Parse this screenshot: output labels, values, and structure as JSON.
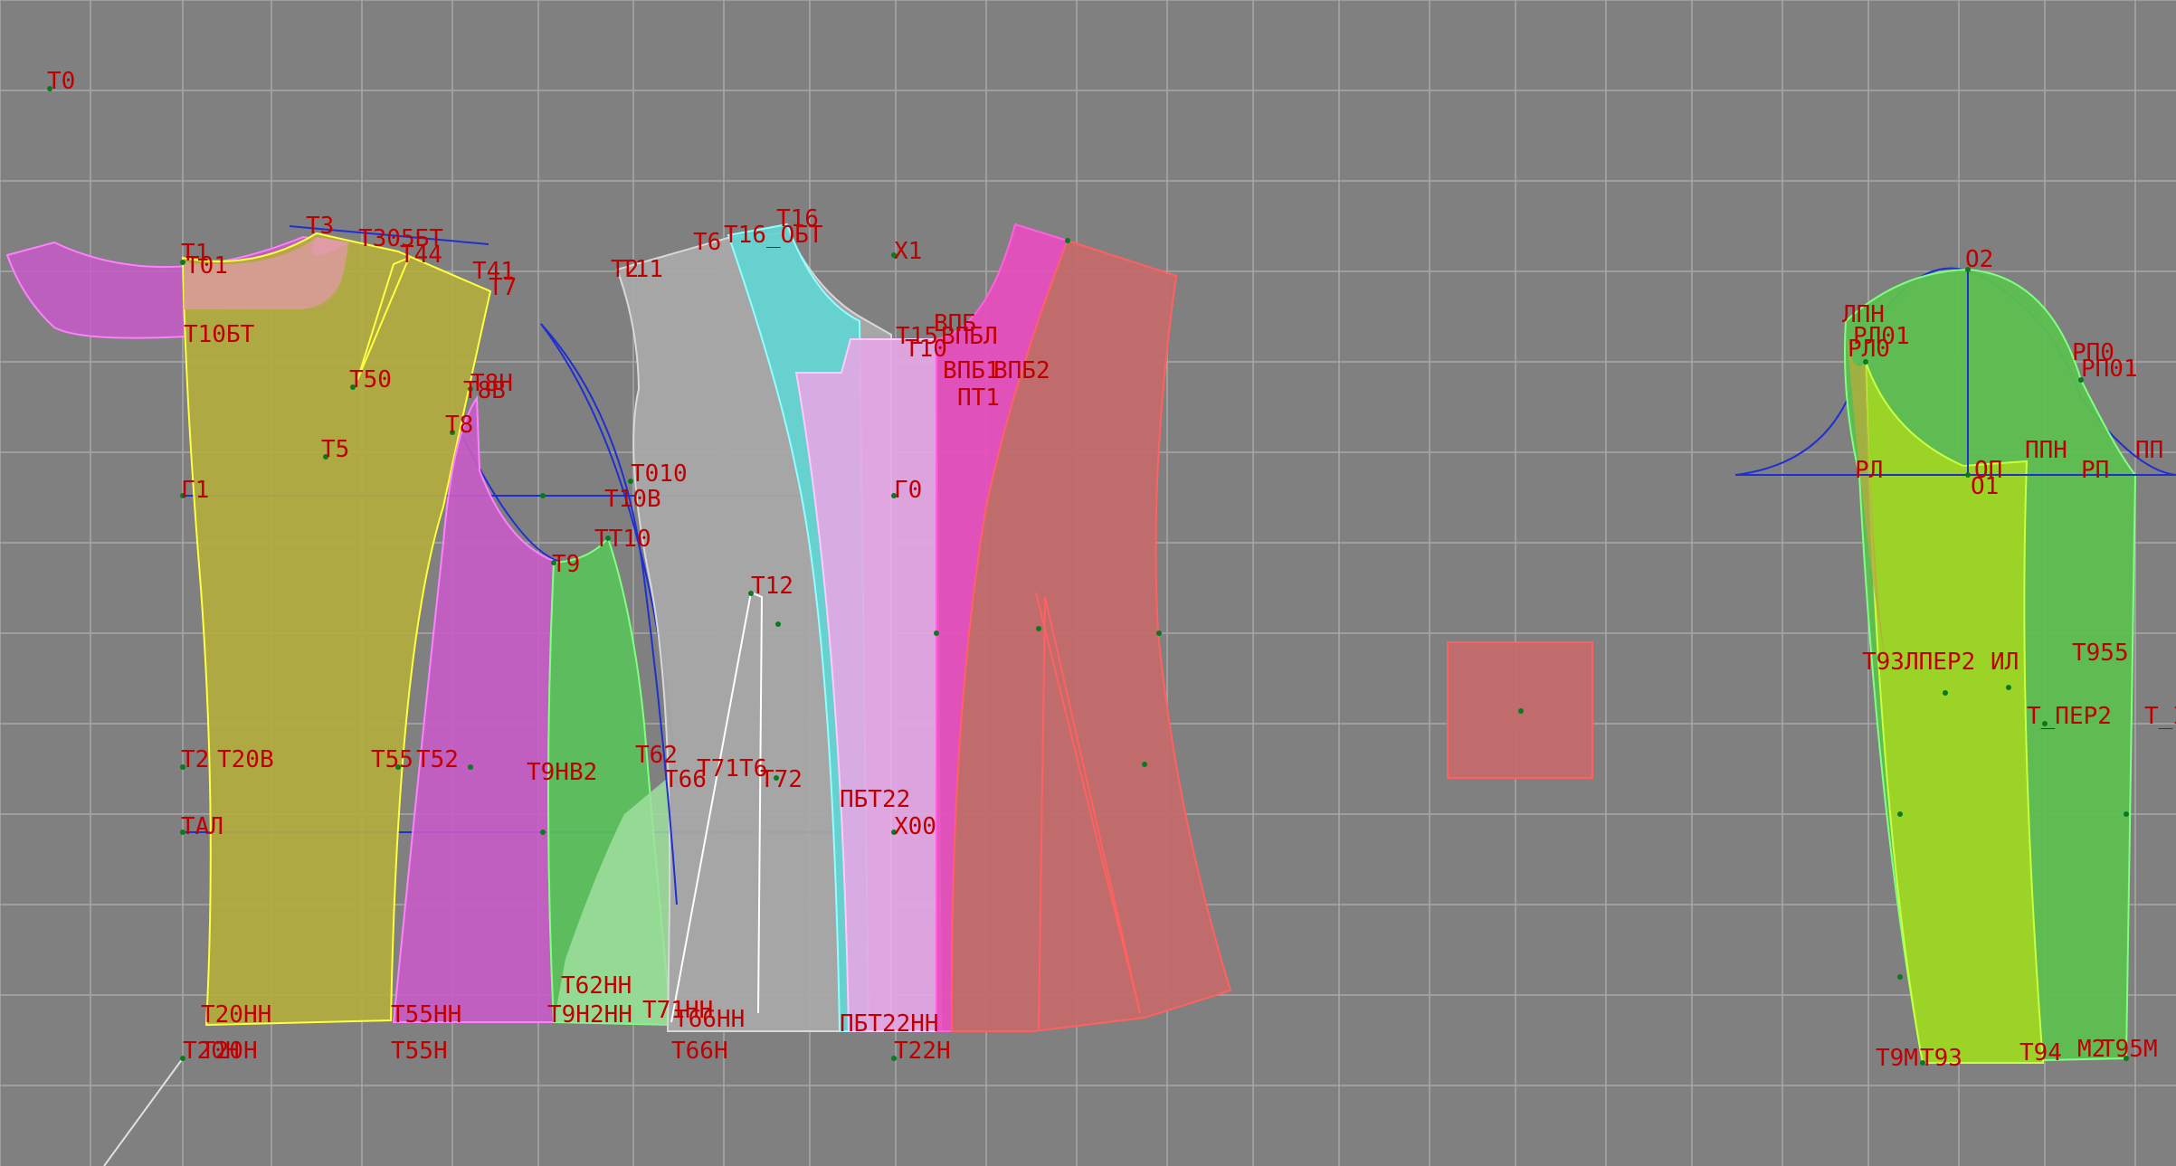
{
  "colors": {
    "background": "#808080",
    "grid": "#a8a8a8",
    "label": "#c00000",
    "construction_line": "#1f2fd0",
    "point": "#0a7a20",
    "yellow_piece": "#b3ad3f",
    "pink_piece": "#c85bc8",
    "green_piece": "#5bbf5b",
    "gray_piece": "#a8a8a8",
    "cyan_piece": "#5fd6d3",
    "light_pink_piece": "#e6a6e6",
    "magenta_piece": "#e84ebf",
    "red_piece": "#c46a6a",
    "sleeve_green": "#5cbf50",
    "sleeve_lime": "#9ed524"
  },
  "labels": [
    {
      "text": "T0"
    },
    {
      "text": "T3"
    },
    {
      "text": "T305БТ"
    },
    {
      "text": "T44"
    },
    {
      "text": "T41"
    },
    {
      "text": "T7"
    },
    {
      "text": "T1"
    },
    {
      "text": "T01"
    },
    {
      "text": "T10БТ"
    },
    {
      "text": "T50"
    },
    {
      "text": "T8H"
    },
    {
      "text": "T8B"
    },
    {
      "text": "T8"
    },
    {
      "text": "T5"
    },
    {
      "text": "Г1"
    },
    {
      "text": "T2"
    },
    {
      "text": "T20B"
    },
    {
      "text": "T55"
    },
    {
      "text": "T52"
    },
    {
      "text": "TАЛ"
    },
    {
      "text": "T20HH"
    },
    {
      "text": "T55HH"
    },
    {
      "text": "T20H"
    },
    {
      "text": "T20H"
    },
    {
      "text": "T55H"
    },
    {
      "text": "T2"
    },
    {
      "text": "T11"
    },
    {
      "text": "T6"
    },
    {
      "text": "T16_ОБТ"
    },
    {
      "text": "T16"
    },
    {
      "text": "X1"
    },
    {
      "text": "T010"
    },
    {
      "text": "T10B"
    },
    {
      "text": "TT10"
    },
    {
      "text": "T9"
    },
    {
      "text": "T12"
    },
    {
      "text": "Г0"
    },
    {
      "text": "T9HB2"
    },
    {
      "text": "T62"
    },
    {
      "text": "T71T6"
    },
    {
      "text": "T66"
    },
    {
      "text": "T72"
    },
    {
      "text": "ПБT22"
    },
    {
      "text": "X00"
    },
    {
      "text": "T62HH"
    },
    {
      "text": "T71HH"
    },
    {
      "text": "T9H2HH"
    },
    {
      "text": "T66HH"
    },
    {
      "text": "ПБT22HH"
    },
    {
      "text": "T66H"
    },
    {
      "text": "T22H"
    },
    {
      "text": "ВПБ"
    },
    {
      "text": "ВПБЛ"
    },
    {
      "text": "T15"
    },
    {
      "text": "T10"
    },
    {
      "text": "ВПБ1"
    },
    {
      "text": "ВПБ2"
    },
    {
      "text": "ПT1"
    },
    {
      "text": "O2"
    },
    {
      "text": "ЛПН"
    },
    {
      "text": "РЛ01"
    },
    {
      "text": "РЛ0"
    },
    {
      "text": "РП0"
    },
    {
      "text": "РП01"
    },
    {
      "text": "РЛ"
    },
    {
      "text": "ОП"
    },
    {
      "text": "O1"
    },
    {
      "text": "ППН"
    },
    {
      "text": "РП"
    },
    {
      "text": "ПП"
    },
    {
      "text": "T9ЗЛПЕР2"
    },
    {
      "text": "ИЛ"
    },
    {
      "text": "T955"
    },
    {
      "text": "T_ПЕР2"
    },
    {
      "text": "T_I"
    },
    {
      "text": "T9M"
    },
    {
      "text": "T93"
    },
    {
      "text": "T94"
    },
    {
      "text": "M2"
    },
    {
      "text": "T95M"
    }
  ]
}
